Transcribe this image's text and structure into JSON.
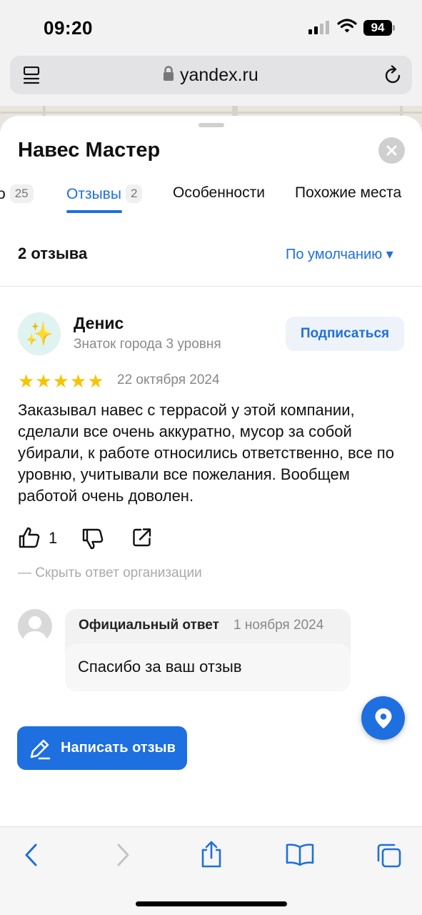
{
  "status": {
    "time": "09:20",
    "battery": "94"
  },
  "browser": {
    "url": "yandex.ru"
  },
  "sheet": {
    "title": "Навес Мастер",
    "tabs": [
      {
        "label": "о",
        "count": "25"
      },
      {
        "label": "Отзывы",
        "count": "2",
        "active": true
      },
      {
        "label": "Особенности"
      },
      {
        "label": "Похожие места"
      }
    ],
    "reviews_count": "2 отзыва",
    "sort_label": "По умолчанию ▾"
  },
  "review": {
    "avatar_emoji": "✨",
    "author": "Денис",
    "author_level": "Знаток города 3 уровня",
    "subscribe_label": "Подписаться",
    "rating": 5,
    "stars": "★★★★★",
    "date": "22 октября 2024",
    "text": "Заказывал навес с террасой у этой компании, сделали все очень аккуратно, мусор за собой убирали, к работе относились ответственно, все по уровню, учитывали все пожелания. Вообщем работой очень доволен.",
    "likes": "1",
    "hide_reply_label": "— Скрыть ответ организации"
  },
  "org_reply": {
    "label": "Официальный ответ",
    "date": "1 ноября 2024",
    "text": "Спасибо за ваш отзыв"
  },
  "write_review_label": "Написать отзыв",
  "colors": {
    "accent": "#1e6fe0",
    "star": "#f7c400"
  }
}
